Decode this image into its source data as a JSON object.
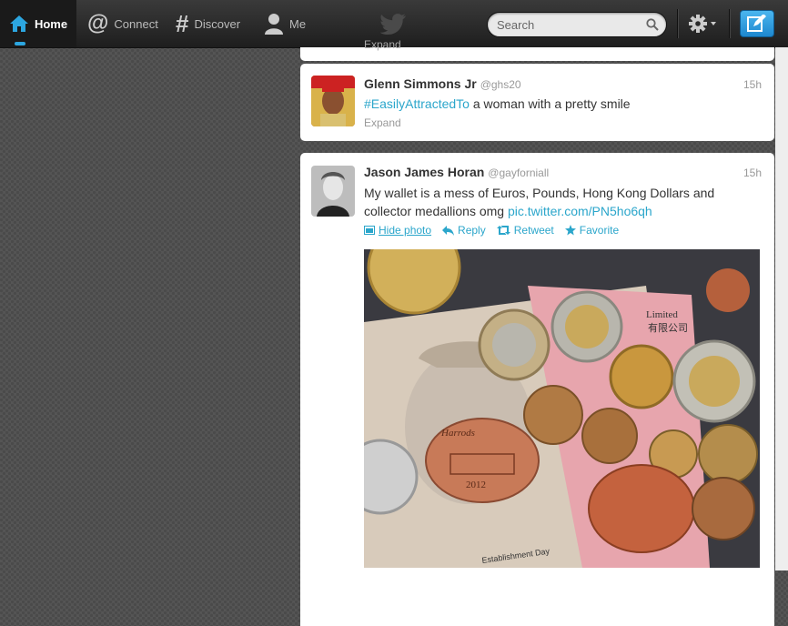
{
  "nav": {
    "home": "Home",
    "connect": "Connect",
    "discover": "Discover",
    "me": "Me"
  },
  "search": {
    "placeholder": "Search"
  },
  "colors": {
    "accent": "#2ba6cb",
    "compose": "#1e88cf",
    "home_indicator": "#2ca6e0"
  },
  "tweets": [
    {
      "expand": "Expand"
    },
    {
      "name": "Glenn Simmons Jr",
      "handle": "@ghs20",
      "time": "15h",
      "hashtag": "#EasilyAttractedTo",
      "text": " a woman with a pretty smile",
      "expand": "Expand"
    },
    {
      "name": "Jason James Horan",
      "handle": "@gayforniall",
      "time": "15h",
      "text": "My wallet is a mess of Euros, Pounds, Hong Kong Dollars and collector medallions omg ",
      "link": "pic.twitter.com/PN5ho6qh",
      "actions": {
        "hide_photo": "Hide photo",
        "reply": "Reply",
        "retweet": "Retweet",
        "favorite": "Favorite"
      },
      "photo": {
        "medal_year": "2012",
        "medal_brand": "Harrods",
        "note_text_1": "Limited",
        "note_text_2": "有限公司",
        "note_text_3": "Establishment Day"
      }
    }
  ]
}
